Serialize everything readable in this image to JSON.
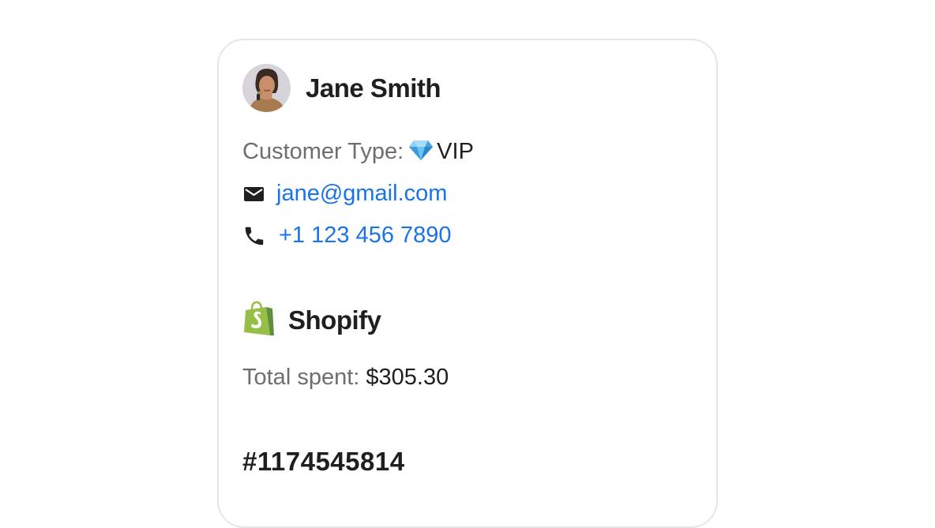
{
  "customer": {
    "name": "Jane Smith",
    "type_label": "Customer Type:",
    "type_value": "VIP",
    "type_icon": "gem-icon",
    "email": "jane@gmail.com",
    "phone": "+1 123 456 7890"
  },
  "store": {
    "name": "Shopify",
    "logo_icon": "shopify-bag-icon",
    "total_spent_label": "Total spent:",
    "total_spent_value": "$305.30"
  },
  "order": {
    "id": "#1174545814"
  },
  "colors": {
    "link": "#1a73e8",
    "shopify_green": "#95bf47",
    "card_border": "#e6e6e6"
  }
}
